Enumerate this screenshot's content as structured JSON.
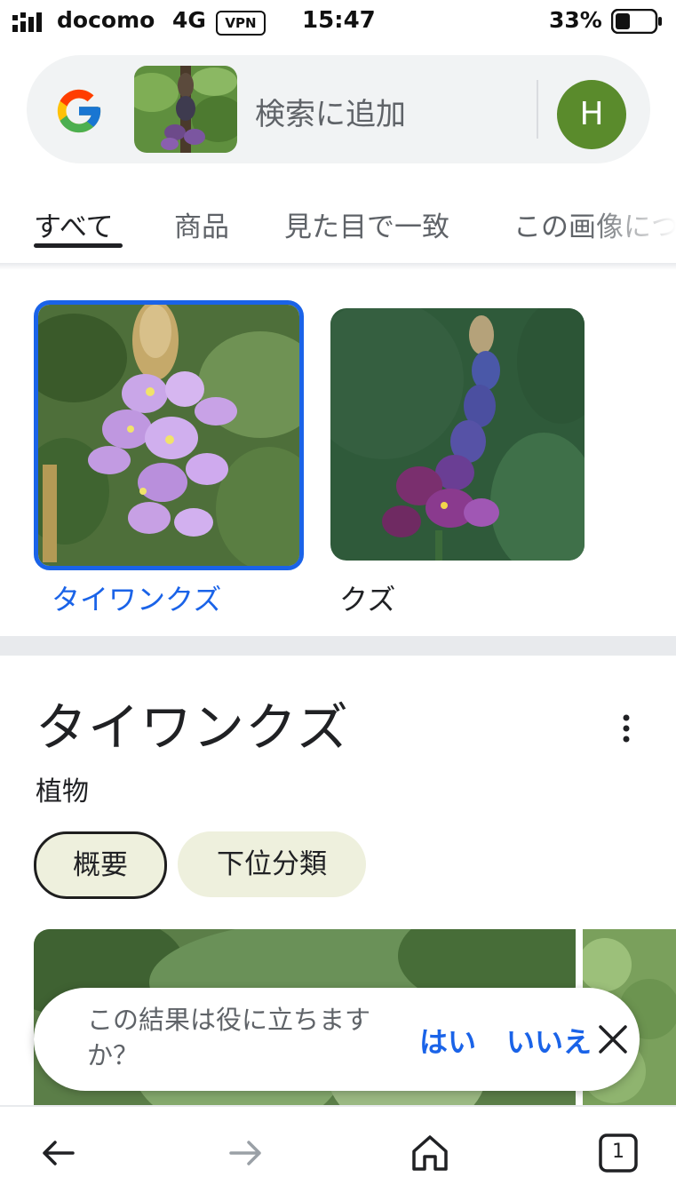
{
  "status_bar": {
    "carrier": "docomo",
    "network": "4G",
    "vpn": "VPN",
    "time": "15:47",
    "battery": "33%"
  },
  "search": {
    "query_placeholder": "検索に追加",
    "avatar_initial": "H"
  },
  "tabs": [
    {
      "label": "すべて",
      "active": true
    },
    {
      "label": "商品"
    },
    {
      "label": "見た目で一致"
    },
    {
      "label": "この画像につ"
    }
  ],
  "results": [
    {
      "label": "タイワンクズ",
      "selected": true
    },
    {
      "label": "クズ"
    }
  ],
  "knowledge_panel": {
    "title": "タイワンクズ",
    "subtitle": "植物",
    "chips": [
      "概要",
      "下位分類"
    ]
  },
  "feedback": {
    "question": "この結果は役に立ちますか？",
    "yes": "はい",
    "no": "いいえ"
  },
  "bottom_nav": {
    "tab_count": "1"
  },
  "colors": {
    "accent_blue": "#1a63e8",
    "avatar_green": "#5a8b2c",
    "chip_bg": "#eef0dd"
  }
}
